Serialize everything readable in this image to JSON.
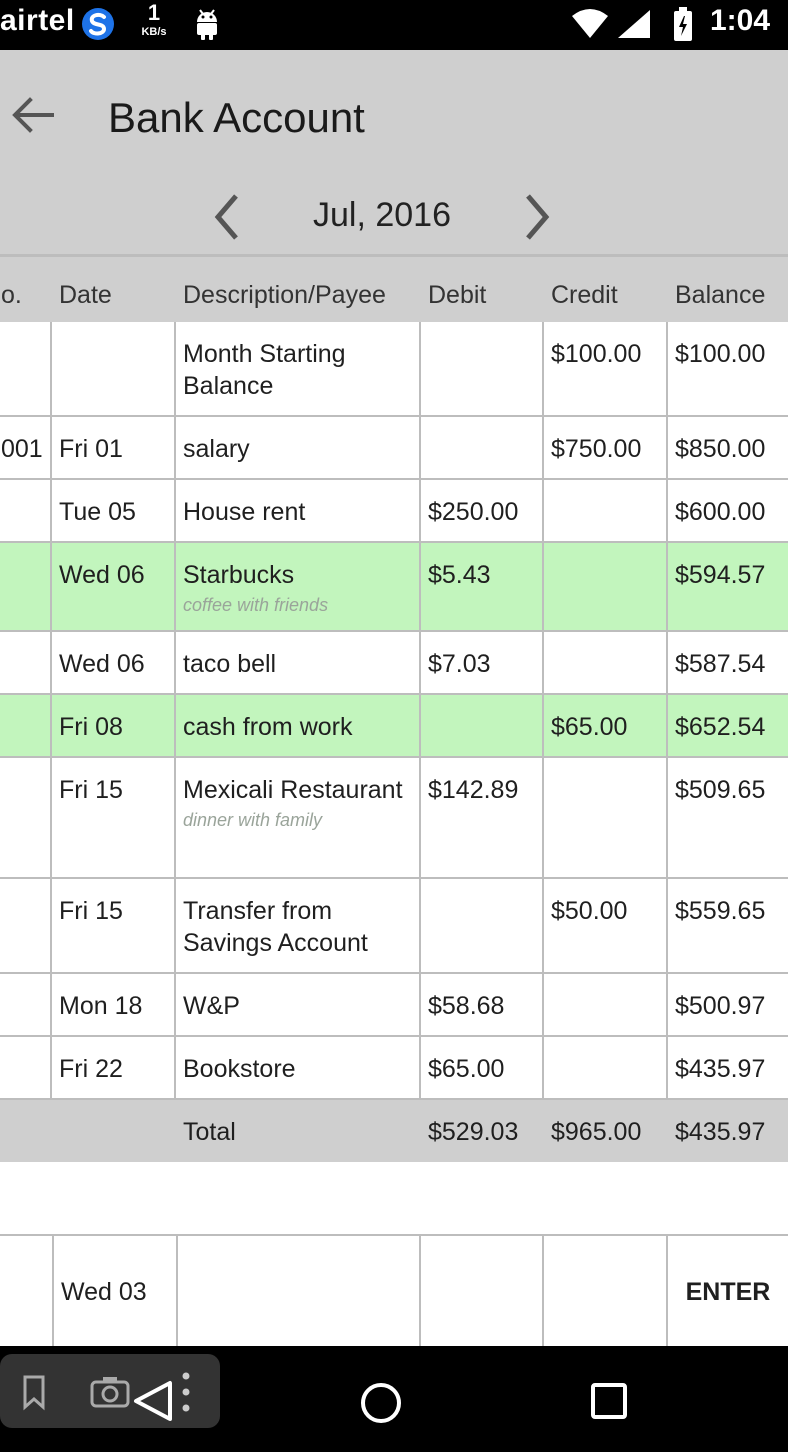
{
  "status_bar": {
    "carrier": "airtel",
    "net_speed": "1",
    "net_unit": "KB/s",
    "time": "1:04",
    "icons": [
      "s-logo-icon",
      "android-icon",
      "wifi-icon",
      "signal-icon",
      "battery-icon"
    ]
  },
  "app_bar": {
    "title": "Bank Account",
    "back_icon": "arrow-left-icon"
  },
  "month_nav": {
    "label": "Jul, 2016",
    "prev_icon": "chevron-left-icon",
    "next_icon": "chevron-right-icon"
  },
  "table": {
    "headers": {
      "no": "o.",
      "date": "Date",
      "desc": "Description/Payee",
      "debit": "Debit",
      "credit": "Credit",
      "balance": "Balance"
    },
    "rows": [
      {
        "no": "",
        "date": "",
        "desc": "Month Starting Balance",
        "note": "",
        "debit": "",
        "credit": "$100.00",
        "balance": "$100.00",
        "highlight": false
      },
      {
        "no": "001",
        "date": "Fri 01",
        "desc": "salary",
        "note": "",
        "debit": "",
        "credit": "$750.00",
        "balance": "$850.00",
        "highlight": false
      },
      {
        "no": "",
        "date": "Tue 05",
        "desc": "House rent",
        "note": "",
        "debit": "$250.00",
        "credit": "",
        "balance": "$600.00",
        "highlight": false
      },
      {
        "no": "",
        "date": "Wed 06",
        "desc": "Starbucks",
        "note": "coffee with friends",
        "debit": "$5.43",
        "credit": "",
        "balance": "$594.57",
        "highlight": true
      },
      {
        "no": "",
        "date": "Wed 06",
        "desc": "taco bell",
        "note": "",
        "debit": "$7.03",
        "credit": "",
        "balance": "$587.54",
        "highlight": false
      },
      {
        "no": "",
        "date": "Fri 08",
        "desc": "cash from work",
        "note": "",
        "debit": "",
        "credit": "$65.00",
        "balance": "$652.54",
        "highlight": true
      },
      {
        "no": "",
        "date": "Fri 15",
        "desc": "Mexicali Restaurant",
        "note": "dinner with family",
        "debit": "$142.89",
        "credit": "",
        "balance": "$509.65",
        "highlight": false
      },
      {
        "no": "",
        "date": "Fri 15",
        "desc": "Transfer from Savings Account",
        "note": "",
        "debit": "",
        "credit": "$50.00",
        "balance": "$559.65",
        "highlight": false
      },
      {
        "no": "",
        "date": "Mon 18",
        "desc": "W&P",
        "note": "",
        "debit": "$58.68",
        "credit": "",
        "balance": "$500.97",
        "highlight": false
      },
      {
        "no": "",
        "date": "Fri 22",
        "desc": "Bookstore",
        "note": "",
        "debit": "$65.00",
        "credit": "",
        "balance": "$435.97",
        "highlight": false
      }
    ],
    "total": {
      "label": "Total",
      "debit": "$529.03",
      "credit": "$965.00",
      "balance": "$435.97"
    }
  },
  "entry": {
    "date": "Wed 03",
    "enter_label": "ENTER"
  },
  "nav_bar": {
    "icons": [
      "bookmark-icon",
      "camera-icon",
      "more-vert-icon",
      "back-triangle-icon",
      "home-circle-icon",
      "recents-square-icon"
    ]
  },
  "colors": {
    "app_bar": "#cfcfcf",
    "highlight_row": "#c2f5bd",
    "grid_line": "#bdbdbd"
  }
}
